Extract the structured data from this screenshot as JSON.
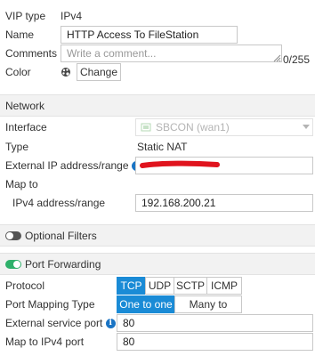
{
  "vip": {
    "type_label": "VIP type",
    "type_value": "IPv4",
    "name_label": "Name",
    "name_value": "HTTP Access To FileStation",
    "comments_label": "Comments",
    "comments_placeholder": "Write a comment...",
    "comments_count": "0/255",
    "color_label": "Color",
    "change_button": "Change"
  },
  "network": {
    "title": "Network",
    "interface_label": "Interface",
    "interface_value": "SBCON (wan1)",
    "type_label": "Type",
    "type_value": "Static NAT",
    "external_ip_label": "External IP address/range",
    "map_to_label": "Map to",
    "ipv4_range_label": "IPv4 address/range",
    "ipv4_range_value": "192.168.200.21"
  },
  "optional_filters": {
    "title": "Optional Filters",
    "enabled": false
  },
  "port_forwarding": {
    "title": "Port Forwarding",
    "enabled": true,
    "protocol_label": "Protocol",
    "protocols": [
      "TCP",
      "UDP",
      "SCTP",
      "ICMP"
    ],
    "protocol_selected": "TCP",
    "port_mapping_label": "Port Mapping Type",
    "port_mapping_options": [
      "One to one",
      "Many to many"
    ],
    "port_mapping_selected": "One to one",
    "external_port_label": "External service port",
    "external_port_value": "80",
    "map_port_label": "Map to IPv4 port",
    "map_port_value": "80"
  },
  "colors": {
    "accent": "#1a8bd6",
    "toggle_on": "#2eb06a",
    "toggle_off": "#555555",
    "redaction": "#e0141e",
    "info_icon": "#1a74c4"
  }
}
